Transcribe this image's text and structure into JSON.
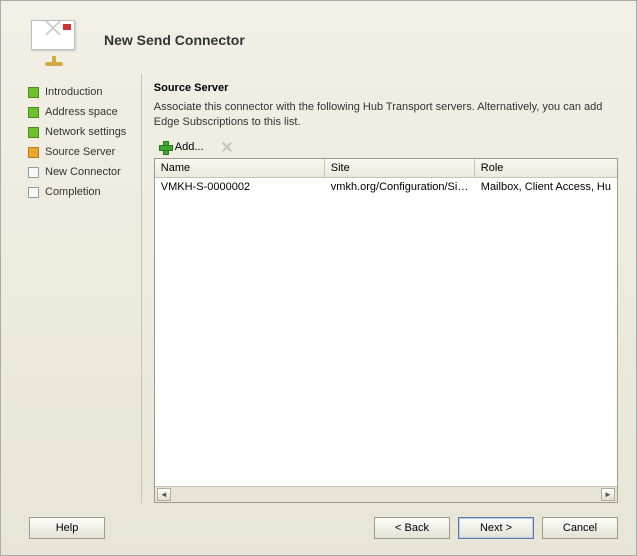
{
  "header": {
    "title": "New Send Connector"
  },
  "sidebar": {
    "steps": [
      {
        "label": "Introduction",
        "state": "done"
      },
      {
        "label": "Address space",
        "state": "done"
      },
      {
        "label": "Network settings",
        "state": "done"
      },
      {
        "label": "Source Server",
        "state": "current"
      },
      {
        "label": "New Connector",
        "state": "pending"
      },
      {
        "label": "Completion",
        "state": "pending"
      }
    ]
  },
  "main": {
    "section_title": "Source Server",
    "description": "Associate this connector with the following Hub Transport servers. Alternatively, you can add Edge Subscriptions to this list.",
    "toolbar": {
      "add_label": "Add..."
    },
    "grid": {
      "columns": {
        "name": "Name",
        "site": "Site",
        "role": "Role"
      },
      "rows": [
        {
          "name": "VMKH-S-0000002",
          "site": "vmkh.org/Configuration/Sit...",
          "role": "Mailbox, Client Access, Hu"
        }
      ]
    }
  },
  "footer": {
    "help": "Help",
    "back": "< Back",
    "next": "Next >",
    "cancel": "Cancel"
  }
}
